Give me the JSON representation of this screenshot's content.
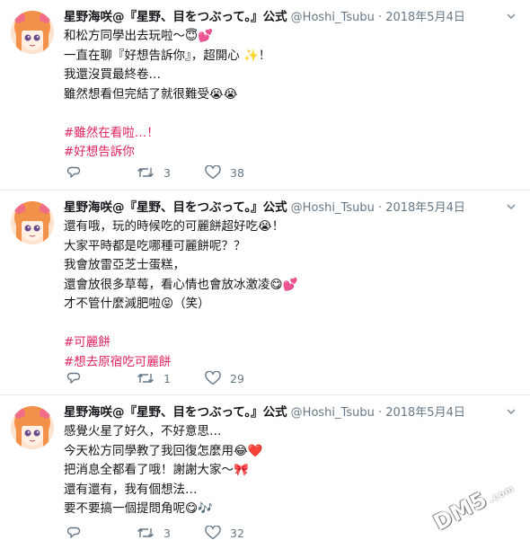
{
  "tweets": [
    {
      "name": "星野海咲@『星野、目をつぶって。』公式",
      "handle": "@Hoshi_Tsubu · 2018年5月4日",
      "lines": [
        {
          "text": "和松方同學出去玩啦～😇💕"
        },
        {
          "text": "一直在聊『好想告訴你』，超開心 ✨！"
        },
        {
          "text": "我還沒買最終卷…"
        },
        {
          "text": "雖然想看但完結了就很難受😭😭"
        },
        {
          "text": ""
        },
        {
          "text": "#雖然在看啦…！",
          "hashtag": true
        },
        {
          "text": "#好想告訴你",
          "hashtag": true
        }
      ],
      "retweets": "3",
      "likes": "38"
    },
    {
      "name": "星野海咲@『星野、目をつぶって。』公式",
      "handle": "@Hoshi_Tsubu · 2018年5月4日",
      "lines": [
        {
          "text": "還有哦，玩的時候吃的可麗餅超好吃😭！"
        },
        {
          "text": "大家平時都是吃哪種可麗餅呢？？"
        },
        {
          "text": "我會放雷亞芝士蛋糕，"
        },
        {
          "text": "還會放很多草莓，看心情也會放冰激凌😋💕"
        },
        {
          "text": "才不管什麼減肥啦😝（笑）"
        },
        {
          "text": ""
        },
        {
          "text": "#可麗餅",
          "hashtag": true
        },
        {
          "text": "#想去原宿吃可麗餅",
          "hashtag": true
        }
      ],
      "retweets": "1",
      "likes": "29"
    },
    {
      "name": "星野海咲@『星野、目をつぶって。』公式",
      "handle": "@Hoshi_Tsubu · 2018年5月4日",
      "lines": [
        {
          "text": "感覺火星了好久，不好意思…"
        },
        {
          "text": "今天松方同學教了我回復怎麼用😂❤️"
        },
        {
          "text": "把消息全都看了哦！謝謝大家～🎀"
        },
        {
          "text": "還有還有，我有個想法…"
        },
        {
          "text": "要不要搞一個提問角呢😋🎶"
        }
      ],
      "retweets": "3",
      "likes": "32"
    }
  ],
  "icons": {
    "reply": "reply-icon",
    "retweet": "retweet-icon",
    "like": "heart-icon",
    "menu": "chevron-down-icon"
  },
  "colors": {
    "hashtag": "#e0245e",
    "secondary_text": "#657786",
    "divider": "#e6ecf0"
  },
  "watermark": {
    "text": "DM5",
    "suffix": ".com"
  }
}
